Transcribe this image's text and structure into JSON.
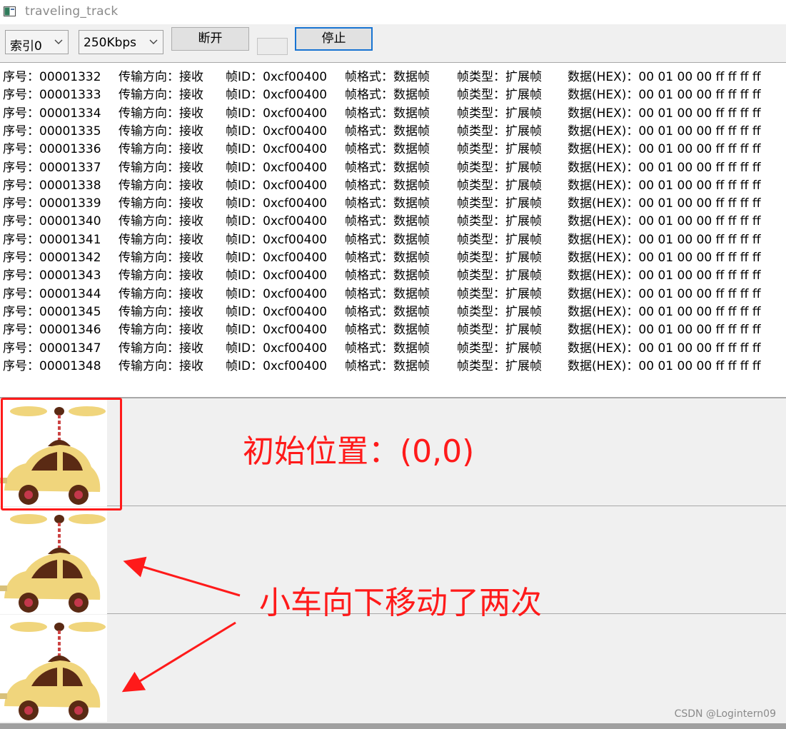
{
  "window": {
    "title": "traveling_track",
    "icon": "window-app-icon"
  },
  "toolbar": {
    "index_select": "索引0",
    "baud_select": "250Kbps",
    "disconnect_label": "断开",
    "stop_label": "停止"
  },
  "log": {
    "field_labels": {
      "seq": "序号：",
      "direction": "传输方向：",
      "frame_id": "帧ID：",
      "frame_format": "帧格式：",
      "frame_type": "帧类型：",
      "data_hex": "数据(HEX)："
    },
    "rows": [
      {
        "seq": "00001332",
        "direction": "接收",
        "frame_id": "0xcf00400",
        "frame_format": "数据帧",
        "frame_type": "扩展帧",
        "data_hex": "00 01 00 00 ff ff ff ff"
      },
      {
        "seq": "00001333",
        "direction": "接收",
        "frame_id": "0xcf00400",
        "frame_format": "数据帧",
        "frame_type": "扩展帧",
        "data_hex": "00 01 00 00 ff ff ff ff"
      },
      {
        "seq": "00001334",
        "direction": "接收",
        "frame_id": "0xcf00400",
        "frame_format": "数据帧",
        "frame_type": "扩展帧",
        "data_hex": "00 01 00 00 ff ff ff ff"
      },
      {
        "seq": "00001335",
        "direction": "接收",
        "frame_id": "0xcf00400",
        "frame_format": "数据帧",
        "frame_type": "扩展帧",
        "data_hex": "00 01 00 00 ff ff ff ff"
      },
      {
        "seq": "00001336",
        "direction": "接收",
        "frame_id": "0xcf00400",
        "frame_format": "数据帧",
        "frame_type": "扩展帧",
        "data_hex": "00 01 00 00 ff ff ff ff"
      },
      {
        "seq": "00001337",
        "direction": "接收",
        "frame_id": "0xcf00400",
        "frame_format": "数据帧",
        "frame_type": "扩展帧",
        "data_hex": "00 01 00 00 ff ff ff ff"
      },
      {
        "seq": "00001338",
        "direction": "接收",
        "frame_id": "0xcf00400",
        "frame_format": "数据帧",
        "frame_type": "扩展帧",
        "data_hex": "00 01 00 00 ff ff ff ff"
      },
      {
        "seq": "00001339",
        "direction": "接收",
        "frame_id": "0xcf00400",
        "frame_format": "数据帧",
        "frame_type": "扩展帧",
        "data_hex": "00 01 00 00 ff ff ff ff"
      },
      {
        "seq": "00001340",
        "direction": "接收",
        "frame_id": "0xcf00400",
        "frame_format": "数据帧",
        "frame_type": "扩展帧",
        "data_hex": "00 01 00 00 ff ff ff ff"
      },
      {
        "seq": "00001341",
        "direction": "接收",
        "frame_id": "0xcf00400",
        "frame_format": "数据帧",
        "frame_type": "扩展帧",
        "data_hex": "00 01 00 00 ff ff ff ff"
      },
      {
        "seq": "00001342",
        "direction": "接收",
        "frame_id": "0xcf00400",
        "frame_format": "数据帧",
        "frame_type": "扩展帧",
        "data_hex": "00 01 00 00 ff ff ff ff"
      },
      {
        "seq": "00001343",
        "direction": "接收",
        "frame_id": "0xcf00400",
        "frame_format": "数据帧",
        "frame_type": "扩展帧",
        "data_hex": "00 01 00 00 ff ff ff ff"
      },
      {
        "seq": "00001344",
        "direction": "接收",
        "frame_id": "0xcf00400",
        "frame_format": "数据帧",
        "frame_type": "扩展帧",
        "data_hex": "00 01 00 00 ff ff ff ff"
      },
      {
        "seq": "00001345",
        "direction": "接收",
        "frame_id": "0xcf00400",
        "frame_format": "数据帧",
        "frame_type": "扩展帧",
        "data_hex": "00 01 00 00 ff ff ff ff"
      },
      {
        "seq": "00001346",
        "direction": "接收",
        "frame_id": "0xcf00400",
        "frame_format": "数据帧",
        "frame_type": "扩展帧",
        "data_hex": "00 01 00 00 ff ff ff ff"
      },
      {
        "seq": "00001347",
        "direction": "接收",
        "frame_id": "0xcf00400",
        "frame_format": "数据帧",
        "frame_type": "扩展帧",
        "data_hex": "00 01 00 00 ff ff ff ff"
      },
      {
        "seq": "00001348",
        "direction": "接收",
        "frame_id": "0xcf00400",
        "frame_format": "数据帧",
        "frame_type": "扩展帧",
        "data_hex": "00 01 00 00 ff ff ff ff"
      }
    ]
  },
  "track": {
    "car_icon": "helicopter-car-icon",
    "annotation_initial": "初始位置：(0,0)",
    "annotation_moved": "小车向下移动了两次",
    "annotation_color": "#ff1a1a"
  },
  "watermark": "CSDN @Logintern09",
  "colors": {
    "accent": "#1874d2",
    "annotation": "#ff1a1a",
    "car_body": "#f0d57c",
    "car_roof": "#5a2a14",
    "car_wheel": "#c4384c"
  }
}
